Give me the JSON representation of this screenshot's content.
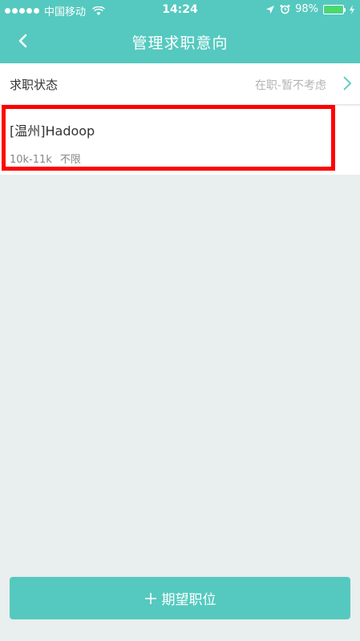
{
  "status_bar": {
    "carrier": "中国移动",
    "time": "14:24",
    "battery": "98%",
    "battery_level": 0.98
  },
  "nav": {
    "title": "管理求职意向"
  },
  "job_status": {
    "label": "求职状态",
    "value": "在职-暂不考虑"
  },
  "intents": [
    {
      "title": "[温州]Hadoop",
      "salary": "10k-11k",
      "extra": "不限"
    }
  ],
  "actions": {
    "add_label": "期望职位"
  },
  "colors": {
    "accent": "#55c9bf",
    "background": "#e9eeee",
    "highlight": "#ff0000"
  },
  "icons": [
    "signal-dots-icon",
    "wifi-icon",
    "location-arrow-icon",
    "alarm-icon",
    "battery-icon",
    "charging-icon",
    "back-arrow-icon",
    "chevron-right-icon",
    "plus-icon"
  ]
}
